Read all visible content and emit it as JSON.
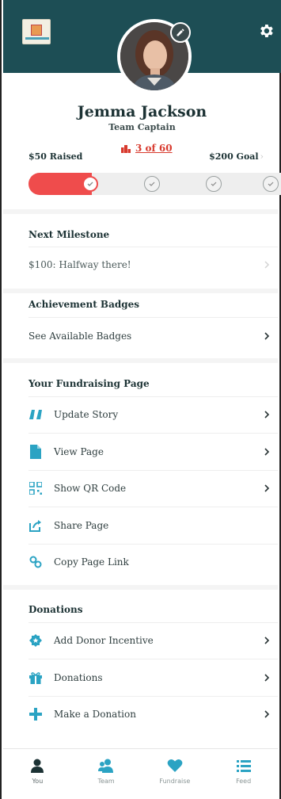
{
  "profile": {
    "name": "Jemma Jackson",
    "role": "Team Captain"
  },
  "progress": {
    "raised": "$50 Raised",
    "goal": "$200 Goal",
    "goal_chevron": "›",
    "rank": "3 of 60",
    "fraction": 0.25,
    "colors": {
      "fill": "#ef4c4c",
      "track": "#eeeeee"
    }
  },
  "milestone": {
    "title": "Next Milestone",
    "text": "$100: Halfway there!"
  },
  "badges": {
    "title": "Achievement Badges",
    "link": "See Available Badges"
  },
  "fundraising_page": {
    "title": "Your Fundraising Page",
    "items": [
      {
        "label": "Update Story",
        "icon": "quote-icon"
      },
      {
        "label": "View Page",
        "icon": "document-icon"
      },
      {
        "label": "Show QR Code",
        "icon": "qr-code-icon"
      },
      {
        "label": "Share Page",
        "icon": "share-icon"
      },
      {
        "label": "Copy Page Link",
        "icon": "link-icon"
      }
    ]
  },
  "donations": {
    "title": "Donations",
    "items": [
      {
        "label": "Add Donor Incentive",
        "icon": "badge-icon"
      },
      {
        "label": "Donations",
        "icon": "gift-icon"
      },
      {
        "label": "Make a Donation",
        "icon": "plus-icon"
      }
    ]
  },
  "nav": {
    "tabs": [
      {
        "label": "You",
        "icon": "person-icon",
        "active": true
      },
      {
        "label": "Team",
        "icon": "team-icon",
        "active": false
      },
      {
        "label": "Fundraise",
        "icon": "heart-icon",
        "active": false
      },
      {
        "label": "Feed",
        "icon": "list-icon",
        "active": false
      }
    ]
  },
  "colors": {
    "header": "#1d4e55",
    "accent": "#2ba3c3",
    "progress": "#ef4c4c",
    "rank": "#d83a2e"
  }
}
